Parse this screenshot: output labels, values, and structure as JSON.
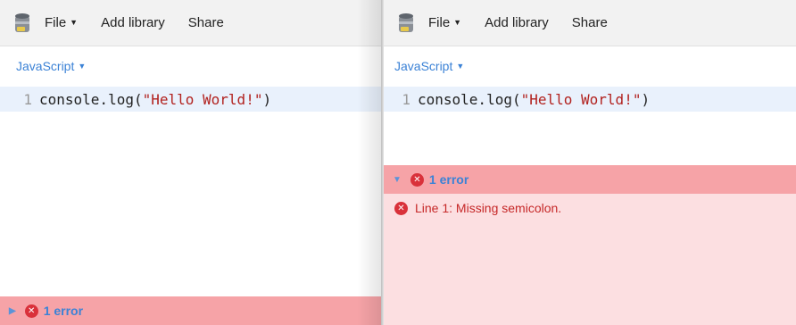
{
  "left": {
    "toolbar": {
      "file_label": "File",
      "add_library_label": "Add library",
      "share_label": "Share"
    },
    "language_label": "JavaScript",
    "editor": {
      "line_number": "1",
      "code_prefix": "console.log(",
      "code_string": "\"Hello World!\"",
      "code_suffix": ")"
    },
    "error_summary": {
      "label": "1 error",
      "expanded": false
    }
  },
  "right": {
    "toolbar": {
      "file_label": "File",
      "add_library_label": "Add library",
      "share_label": "Share"
    },
    "language_label": "JavaScript",
    "editor": {
      "line_number": "1",
      "code_prefix": "console.log(",
      "code_string": "\"Hello World!\"",
      "code_suffix": ")"
    },
    "error_summary": {
      "label": "1 error",
      "expanded": true
    },
    "errors": [
      {
        "message": "Line 1: Missing semicolon."
      }
    ]
  },
  "icons": {
    "app": "database-jar-icon",
    "dropdown": "caret-down-icon",
    "collapsed": "triangle-right-icon",
    "expanded": "triangle-down-icon",
    "error": "error-x-circle-icon"
  },
  "colors": {
    "toolbar_bg": "#f2f2f2",
    "accent_blue": "#3b82d6",
    "active_line_bg": "#e9f1fc",
    "string_red": "#b2221f",
    "error_header_bg": "#f6a3a7",
    "error_body_bg": "#fcdfe1",
    "error_icon": "#d9313a"
  }
}
